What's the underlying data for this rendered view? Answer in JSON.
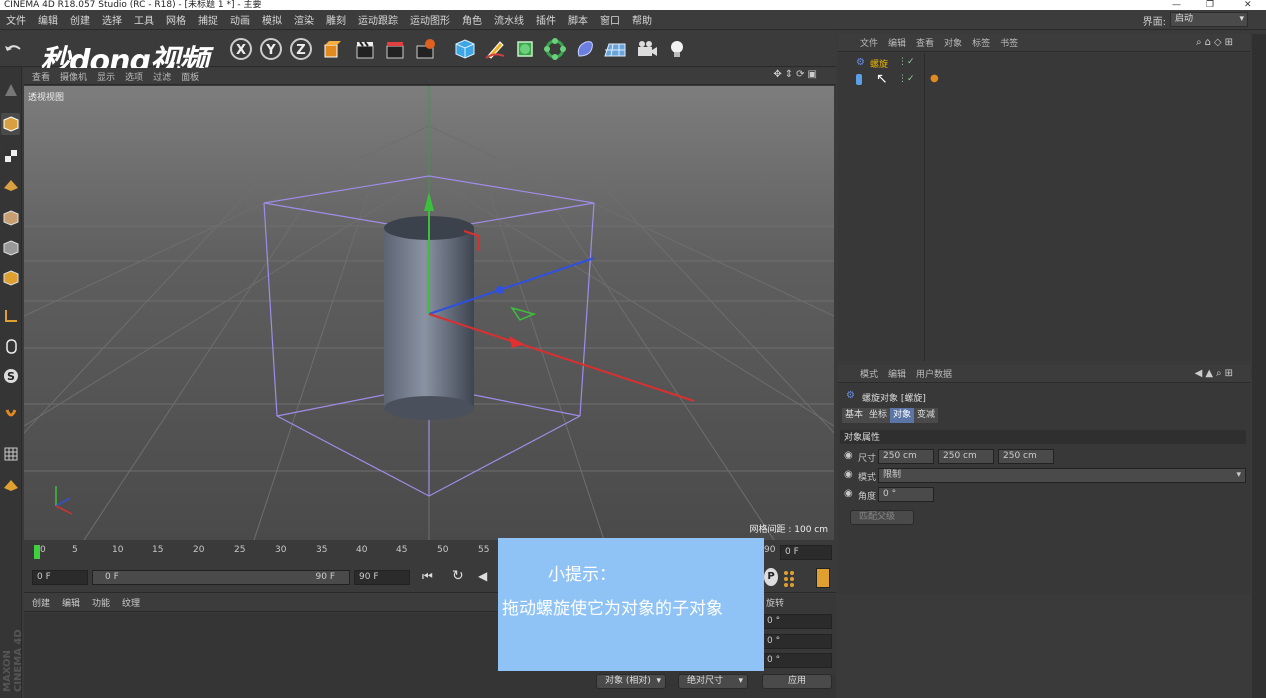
{
  "window": {
    "title": "CINEMA 4D R18.057 Studio (RC - R18) - [未标题 1 *] - 主要"
  },
  "menubar": {
    "items": [
      "文件",
      "编辑",
      "创建",
      "选择",
      "工具",
      "网格",
      "捕捉",
      "动画",
      "模拟",
      "渲染",
      "雕刻",
      "运动跟踪",
      "运动图形",
      "角色",
      "流水线",
      "插件",
      "脚本",
      "窗口",
      "帮助"
    ],
    "layout_label": "界面:",
    "layout_value": "启动"
  },
  "watermark": {
    "text": "秒dong视频"
  },
  "viewport": {
    "menu": [
      "查看",
      "摄像机",
      "显示",
      "选项",
      "过滤",
      "面板"
    ],
    "label": "透视视图",
    "grid_spacing": "网格间距 : 100 cm"
  },
  "timeline": {
    "ticks": [
      "0",
      "5",
      "10",
      "15",
      "20",
      "25",
      "30",
      "35",
      "40",
      "45",
      "50",
      "55"
    ],
    "end_tick": "90",
    "current_frame": "0 F"
  },
  "transport": {
    "start_field": "0 F",
    "range_start": "0 F",
    "range_end": "90 F",
    "end_field": "90 F"
  },
  "materials": {
    "menu": [
      "创建",
      "编辑",
      "功能",
      "纹理"
    ]
  },
  "object_manager": {
    "menu": [
      "文件",
      "编辑",
      "查看",
      "对象",
      "标签",
      "书签"
    ],
    "objects": [
      {
        "name": "螺旋"
      },
      {
        "name": ""
      }
    ]
  },
  "attribute_manager": {
    "menu": [
      "模式",
      "编辑",
      "用户数据"
    ],
    "title": "螺旋对象 [螺旋]",
    "tabs": [
      "基本",
      "坐标",
      "对象",
      "变减"
    ],
    "active_tab": 2,
    "section": "对象属性",
    "size_label": "尺寸",
    "size_values": [
      "250 cm",
      "250 cm",
      "250 cm"
    ],
    "mode_label": "模式",
    "mode_value": "限制",
    "angle_label": "角度",
    "angle_value": "0 °",
    "fit_button": "匹配父级"
  },
  "coordinates": {
    "header": "旋转",
    "values": [
      "0 °",
      "0 °",
      "0 °"
    ],
    "mode_select": "对象 (相对)",
    "size_select": "绝对尺寸",
    "apply": "应用"
  },
  "tip": {
    "title": "小提示：",
    "body": "拖动螺旋使它为对象的子对象"
  },
  "vertical_logo": "MAXON CINEMA 4D",
  "colors": {
    "accent": "#5b76a6",
    "tip_bg": "#90c3f5",
    "selected_object": "#e8b400"
  }
}
